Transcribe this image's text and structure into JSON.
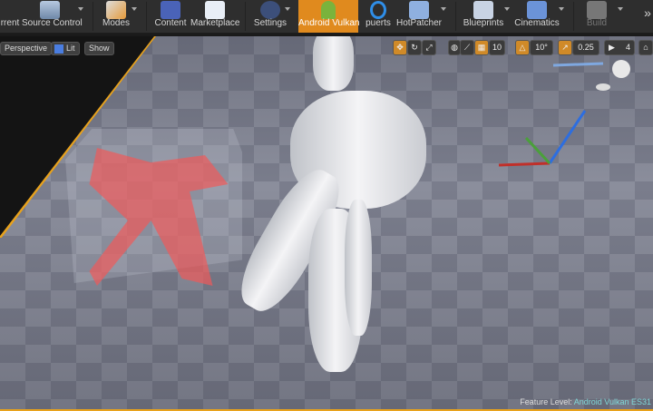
{
  "toolbar": {
    "items": [
      {
        "label": "rrent",
        "icon": "current-icon"
      },
      {
        "label": "Source Control",
        "icon": "source-control-icon"
      },
      {
        "label": "Modes",
        "icon": "modes-icon"
      },
      {
        "label": "Content",
        "icon": "content-icon"
      },
      {
        "label": "Marketplace",
        "icon": "marketplace-icon"
      },
      {
        "label": "Settings",
        "icon": "settings-icon"
      },
      {
        "label": "Android Vulkan",
        "icon": "android-icon"
      },
      {
        "label": "puerts",
        "icon": "puerts-icon"
      },
      {
        "label": "HotPatcher",
        "icon": "hotpatcher-icon"
      },
      {
        "label": "Blueprints",
        "icon": "blueprints-icon"
      },
      {
        "label": "Cinematics",
        "icon": "cinematics-icon"
      },
      {
        "label": "Build",
        "icon": "build-icon"
      }
    ],
    "overflow": "»",
    "accent": "#e08a1e"
  },
  "viewport": {
    "perspective": "Perspective",
    "lit": "Lit",
    "show": "Show",
    "grid_snap": "10",
    "rotation_snap": "10°",
    "scale_snap": "0.25",
    "camera_speed": "4"
  },
  "status": {
    "label": "Feature Level:",
    "value": "Android Vulkan ES31"
  }
}
